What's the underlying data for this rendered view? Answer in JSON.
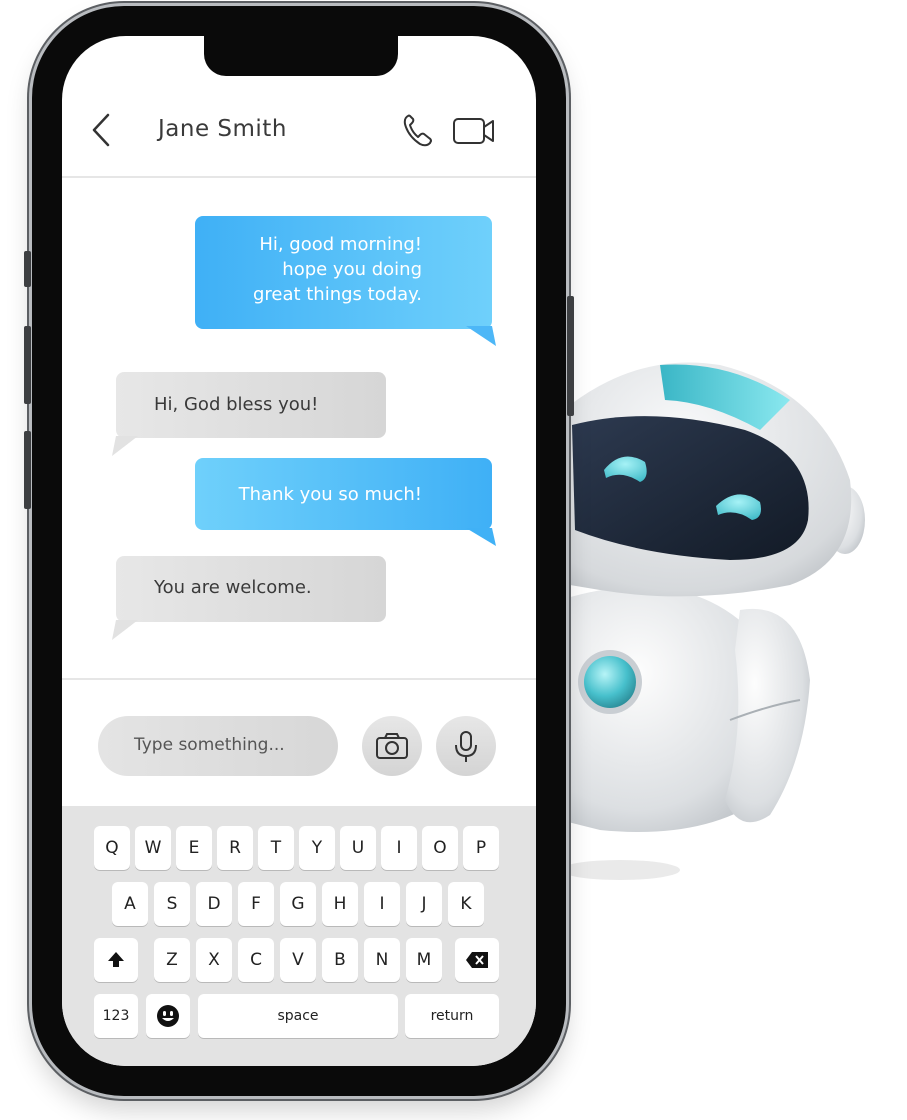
{
  "chat": {
    "contact_name": "Jane Smith",
    "messages": [
      {
        "direction": "outgoing",
        "text": "Hi, good morning!\nhope you doing\ngreat things today."
      },
      {
        "direction": "incoming",
        "text": "Hi, God bless you!"
      },
      {
        "direction": "outgoing",
        "text": "Thank you so much!"
      },
      {
        "direction": "incoming",
        "text": "You are welcome."
      }
    ]
  },
  "composer": {
    "placeholder": "Type something..."
  },
  "icons": {
    "back": "chevron-left-icon",
    "call": "phone-icon",
    "video": "video-camera-icon",
    "camera": "camera-icon",
    "mic": "microphone-icon",
    "shift": "shift-arrow-icon",
    "backspace": "backspace-icon",
    "emoji": "emoji-icon"
  },
  "keyboard": {
    "row1": [
      "Q",
      "W",
      "E",
      "R",
      "T",
      "Y",
      "U",
      "I",
      "O",
      "P"
    ],
    "row2": [
      "A",
      "S",
      "D",
      "F",
      "G",
      "H",
      "I",
      "J",
      "K"
    ],
    "row3": [
      "Z",
      "X",
      "C",
      "V",
      "B",
      "N",
      "M"
    ],
    "numbers_label": "123",
    "space_label": "space",
    "return_label": "return"
  },
  "colors": {
    "outgoing_bubble": "#3fb0f6",
    "incoming_bubble": "#d9d9d9",
    "robot_accent": "#4fc9d6",
    "robot_face": "#1f2a3a"
  }
}
